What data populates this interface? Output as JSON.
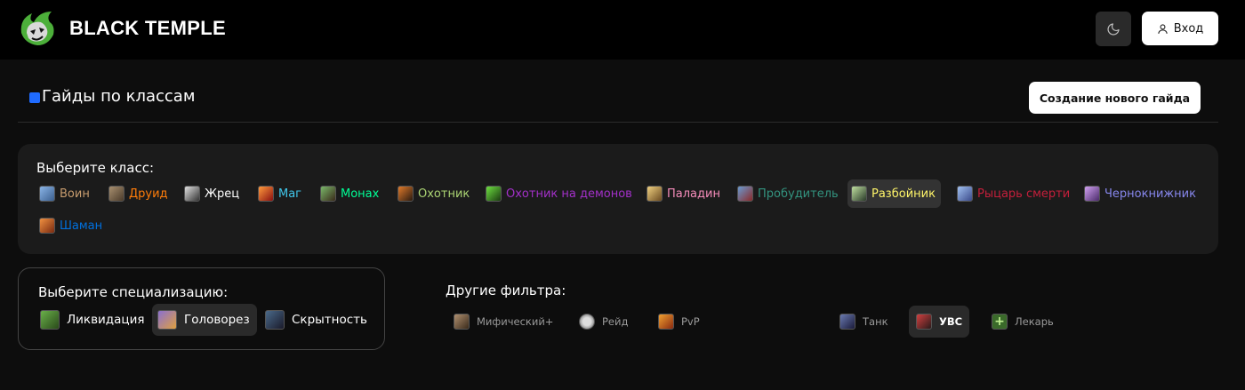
{
  "header": {
    "brand": "BLACK TEMPLE",
    "login_label": "Вход"
  },
  "page": {
    "title": "Гайды по классам",
    "new_guide_label": "Создание нового гайда",
    "accent_color": "#1f6bff"
  },
  "classes": {
    "label": "Выберите класс:",
    "items": [
      {
        "label": "Воин",
        "color": "#c79c6e",
        "icon": "warrior-icon"
      },
      {
        "label": "Друид",
        "color": "#ff7d0a",
        "icon": "druid-icon"
      },
      {
        "label": "Жрец",
        "color": "#ffffff",
        "icon": "priest-icon"
      },
      {
        "label": "Маг",
        "color": "#40c7eb",
        "icon": "mage-icon"
      },
      {
        "label": "Монах",
        "color": "#00ff96",
        "icon": "monk-icon"
      },
      {
        "label": "Охотник",
        "color": "#abd473",
        "icon": "hunter-icon"
      },
      {
        "label": "Охотник на демонов",
        "color": "#a330c9",
        "icon": "demon-hunter-icon"
      },
      {
        "label": "Паладин",
        "color": "#f58cba",
        "icon": "paladin-icon"
      },
      {
        "label": "Пробудитель",
        "color": "#33937f",
        "icon": "evoker-icon"
      },
      {
        "label": "Разбойник",
        "color": "#fff569",
        "icon": "rogue-icon",
        "active": true
      },
      {
        "label": "Рыцарь смерти",
        "color": "#c41f3b",
        "icon": "death-knight-icon"
      },
      {
        "label": "Чернокнижник",
        "color": "#8787ed",
        "icon": "warlock-icon"
      },
      {
        "label": "Шаман",
        "color": "#0070de",
        "icon": "shaman-icon"
      }
    ]
  },
  "specs": {
    "label": "Выберите специализацию:",
    "items": [
      {
        "label": "Ликвидация",
        "icon": "assassination-icon"
      },
      {
        "label": "Головорез",
        "icon": "outlaw-icon",
        "active": true
      },
      {
        "label": "Скрытность",
        "icon": "subtlety-icon"
      }
    ]
  },
  "filters": {
    "label": "Другие фильтра:",
    "items": [
      {
        "label": "Мифический+",
        "icon": "mythic-plus-icon"
      },
      {
        "label": "Рейд",
        "icon": "raid-icon"
      },
      {
        "label": "PvP",
        "icon": "pvp-icon"
      },
      {
        "label": "Танк",
        "icon": "tank-icon"
      },
      {
        "label": "УВС",
        "icon": "damage-icon",
        "active": true
      },
      {
        "label": "Лекарь",
        "icon": "healer-icon"
      }
    ]
  }
}
